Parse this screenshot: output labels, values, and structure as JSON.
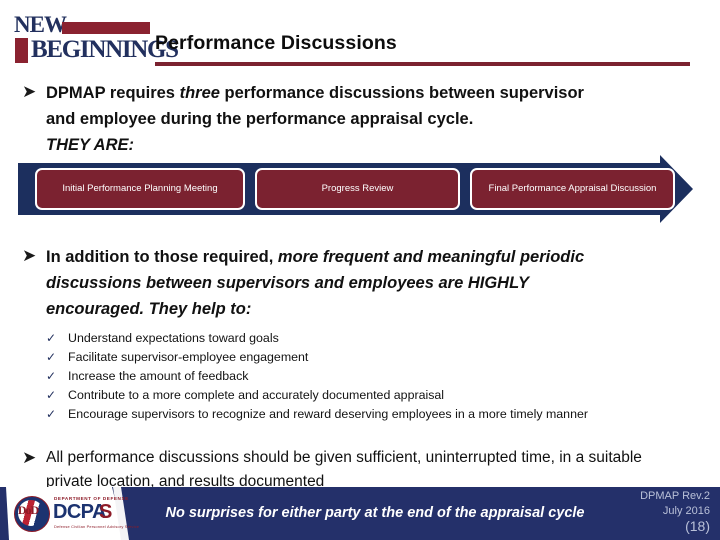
{
  "logo": {
    "line1": "NEW",
    "line2": "BEGINNINGS",
    "accent_navy": "#22305e",
    "accent_red": "#8a2230"
  },
  "header": {
    "title": "Performance Discussions",
    "rule_color": "#7b2230"
  },
  "bullets": [
    {
      "marker": "➤",
      "line1_a": "DPMAP requires ",
      "line1_i": "three",
      "line1_b": " performance discussions between supervisor",
      "line2": "and employee during the performance appraisal cycle.",
      "line3": "THEY ARE:"
    },
    {
      "marker": "➤",
      "line1_a": "In addition to those required, ",
      "line1_i": "more frequent and meaningful periodic",
      "line2": "discussions between supervisors and employees are HIGHLY",
      "line3": "encouraged. They help to:"
    },
    {
      "marker": "➤",
      "line1": "All performance discussions should be given sufficient, uninterrupted time, in a suitable",
      "line2": "private location, and results documented"
    }
  ],
  "process": {
    "arrow_color": "#1c2f5e",
    "box_color": "#7b2230",
    "steps": [
      {
        "label": "Initial Performance Planning Meeting"
      },
      {
        "label": "Progress Review"
      },
      {
        "label": "Final Performance Appraisal Discussion"
      }
    ]
  },
  "checklist": {
    "mark": "✓",
    "items": [
      "Understand expectations toward goals",
      "Facilitate supervisor-employee engagement",
      "Increase the amount of feedback",
      "Contribute to a more complete and accurately documented appraisal",
      "Encourage supervisors to recognize and reward deserving employees in a more timely manner"
    ]
  },
  "footer": {
    "banner_color": "#24306a",
    "tagline": "No surprises for  either party at the end of the appraisal cycle",
    "revision": "DPMAP Rev.2",
    "date": "July 2016",
    "page": "(18)",
    "agency_logo": {
      "department": "DEPARTMENT OF DEFENSE",
      "acronym": "DCPA",
      "acronym_x": "S",
      "seal_letters": "DoD",
      "subtitle": "Defense Civilian Personnel Advisory Service"
    }
  }
}
